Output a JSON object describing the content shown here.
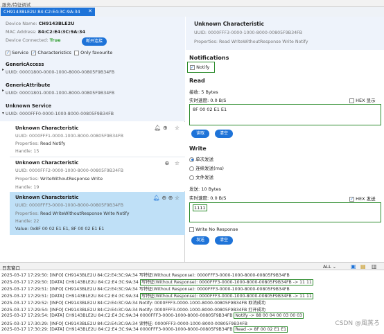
{
  "topbar": {
    "title": "服务/特征调试"
  },
  "tab": {
    "label": "CH9143BLE2U 84:C2:E4:3C:9A:34"
  },
  "device": {
    "name_label": "Device Name:",
    "name": "CH9143BLE2U",
    "mac_label": "MAC Address:",
    "mac": "84:C2:E4:3C:9A:34",
    "conn_label": "Device Connected:",
    "conn": "True",
    "disconnect_btn": "断开连接",
    "filter_service": "Service",
    "filter_char": "Characteristics",
    "filter_fav": "Only favourite"
  },
  "services": [
    {
      "name": "GenericAccess",
      "uuid": "UUID: 00001800-0000-1000-8000-00805F9B34FB"
    },
    {
      "name": "GenericAttribute",
      "uuid": "UUID: 00001801-0000-1000-8000-00805F9B34FB"
    },
    {
      "name": "Unknown Service",
      "uuid": "UUID: 0000FFF0-0000-1000-8000-00805F9B34FB"
    }
  ],
  "chars": [
    {
      "name": "Unknown Characteristic",
      "uuid": "UUID: 0000FFF1-0000-1000-8000-00805F9B34FB",
      "props_label": "Properties:",
      "props": "Read Notify",
      "handle": "Handle: 15"
    },
    {
      "name": "Unknown Characteristic",
      "uuid": "UUID: 0000FFF2-0000-1000-8000-00805F9B34FB",
      "props_label": "Properties:",
      "props": "WriteWithoutResponse Write",
      "handle": "Handle: 19"
    },
    {
      "name": "Unknown Characteristic",
      "uuid": "UUID: 0000FFF3-0000-1000-8000-00805F9B34FB",
      "props_label": "Properties:",
      "props": "Read WriteWithoutResponse Write Notify",
      "handle": "Handle: 22",
      "value": "Value: 0x8F 00 02 E1 E1, 8F 00 02 E1 E1"
    }
  ],
  "detail": {
    "title": "Unknown Characteristic",
    "uuid": "UUID: 0000FFF3-0000-1000-8000-00805F9B34FB",
    "props": "Properties: Read WriteWithoutResponse Write Notify",
    "notifications": "Notifications",
    "notify": "Notify",
    "read": "Read",
    "recv": "接收:  5 Bytes",
    "rate": "实时速度:  0.0 B/S",
    "hex_show": "HEX 显示",
    "read_value": "8F 00 02 E1 E1",
    "read_btn": "读取",
    "clear_btn": "清空",
    "write": "Write",
    "opt1": "单次发送",
    "opt2": "连续发送(ms)",
    "opt3": "文件发送",
    "sent": "发送:  10 Bytes",
    "wrate": "实时速度:  0.0 B/S",
    "hex_send": "HEX 发送",
    "write_value": "1111",
    "no_resp": "Write No Response",
    "send_btn": "发送",
    "wclear_btn": "清空"
  },
  "log": {
    "title": "日志窗口",
    "filter": "ALL",
    "lines": [
      [
        "2025-03-17 17:29:50: [INFO] CH9143BLE2U 84:C2:E4:3C:9A:34 ",
        "写特征(Without Response): 0000FFF3-0000-1000-8000-00805F9B34FB",
        ""
      ],
      [
        "2025-03-17 17:29:50: [DATA] CH9143BLE2U 84:C2:E4:3C:9A:34 ",
        "写特征(Without Response): 0000FFF3-0000-1000-8000-00805F9B34FB -> 11 11",
        ""
      ],
      [
        "2025-03-17 17:29:51: [INFO] CH9143BLE2U 84:C2:E4:3C:9A:34 ",
        "写特征(Without Response): 0000FFF3-0000-1000-8000-00805F9B34FB",
        ""
      ],
      [
        "2025-03-17 17:29:51: [DATA] CH9143BLE2U 84:C2:E4:3C:9A:34 ",
        "写特征(Without Response): 0000FFF3-0000-1000-8000-00805F9B34FB -> 11 11",
        ""
      ],
      [
        "2025-03-17 17:29:52: [INFO] CH9143BLE2U 84:C2:E4:3C:9A:34 ",
        "Notify: 0000FFF3-0000-1000-8000-00805F9B34FB 取消成功",
        ""
      ],
      [
        "2025-03-17 17:29:54: [INFO] CH9143BLE2U 84:C2:E4:3C:9A:34 ",
        "Notify: 0000FFF3-0000-1000-8000-00805F9B34FB 打开成功",
        ""
      ],
      [
        "2025-03-17 17:29:54: [DATA] CH9143BLE2U 84:C2:E4:3C:9A:34 0000FFF3-0000-1000-8000-00805F9B34FB ",
        "Notify ->  88 00 04 00 03 00 03",
        ""
      ],
      [
        "2025-03-17 17:30:29: [INFO] CH9143BLE2U 84:C2:E4:3C:9A:34 ",
        "读特征: 0000FFF3-0000-1000-8000-00805F9B34FB",
        ""
      ],
      [
        "2025-03-17 17:30:29: [DATA] CH9143BLE2U 84:C2:E4:3C:9A:34 0000FFF3-0000-1000-8000-00805F9B34FB ",
        "Read -> 8F 00 02 E1 E1",
        ""
      ]
    ]
  },
  "watermark": "CSDN @風蒸ろ"
}
